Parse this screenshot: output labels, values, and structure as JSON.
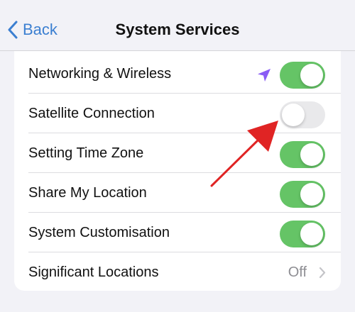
{
  "nav": {
    "back_label": "Back",
    "title": "System Services"
  },
  "settings": [
    {
      "label": "Networking & Wireless",
      "toggle": true,
      "location_indicator": "location-arrow-icon",
      "indicator_color": "#8a5cf5"
    },
    {
      "label": "Satellite Connection",
      "toggle": false
    },
    {
      "label": "Setting Time Zone",
      "toggle": true
    },
    {
      "label": "Share My Location",
      "toggle": true
    },
    {
      "label": "System Customisation",
      "toggle": true
    },
    {
      "label": "Significant Locations",
      "value": "Off",
      "disclosure": "chevron-right-icon"
    }
  ],
  "colors": {
    "accent": "#3b7fd1",
    "toggle_on": "#65c466",
    "toggle_off": "#e9e9eb",
    "annotation_arrow": "#e02424"
  }
}
